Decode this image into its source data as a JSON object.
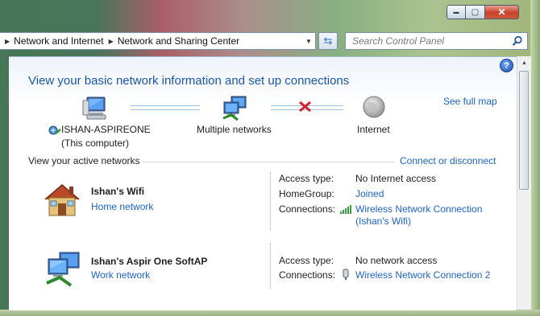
{
  "window": {
    "min_label": "▬",
    "max_label": "▢",
    "close_label": "✕"
  },
  "address": {
    "crumbs": [
      "Network and Internet",
      "Network and Sharing Center"
    ]
  },
  "search": {
    "placeholder": "Search Control Panel"
  },
  "help_label": "?",
  "heading": "View your basic network information and set up connections",
  "map": {
    "see_full_map": "See full map",
    "computer_name": "ISHAN-ASPIREONE",
    "computer_sub": "(This computer)",
    "middle_label": "Multiple networks",
    "internet_label": "Internet"
  },
  "active": {
    "title": "View your active networks",
    "connect_link": "Connect or disconnect",
    "networks": [
      {
        "name": "Ishan's Wifi",
        "type": "Home network",
        "access_label": "Access type:",
        "access_value": "No Internet access",
        "homegroup_label": "HomeGroup:",
        "homegroup_value": "Joined",
        "connections_label": "Connections:",
        "connection_value": "Wireless Network Connection",
        "connection_value2": "(Ishan's Wifi)"
      },
      {
        "name": "Ishan's Aspir One SoftAP",
        "type": "Work network",
        "access_label": "Access type:",
        "access_value": "No network access",
        "connections_label": "Connections:",
        "connection_value": "Wireless Network Connection 2"
      }
    ]
  },
  "colors": {
    "accent": "#1b55a8",
    "link": "#1c63c7",
    "error": "#d0202a"
  }
}
